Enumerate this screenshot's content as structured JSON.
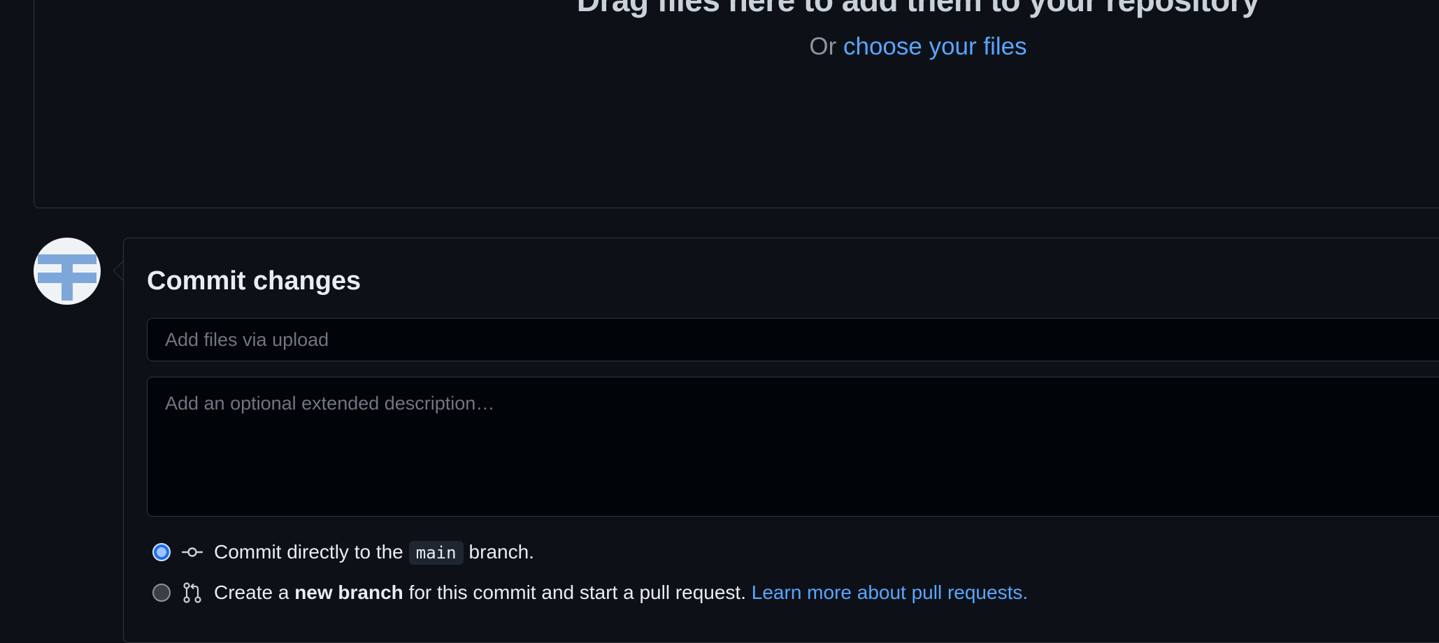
{
  "dropzone": {
    "title": "Drag files here to add them to your repository",
    "prefix": "Or",
    "link_label": "choose your files"
  },
  "commit": {
    "title": "Commit changes",
    "summary_placeholder": "Add files via upload",
    "description_placeholder": "Add an optional extended description…",
    "option_direct": {
      "before": "Commit directly to the",
      "branch": "main",
      "after": "branch."
    },
    "option_new_branch": {
      "before": "Create a",
      "bold": "new branch",
      "middle": "for this commit and start a pull request.",
      "link": "Learn more about pull requests."
    }
  },
  "icons": {
    "avatar": "identicon-avatar",
    "commit": "git-commit-icon",
    "pull_request": "git-pull-request-icon"
  },
  "colors": {
    "background": "#0d1117",
    "border": "#30363d",
    "link": "#58a6ff",
    "muted_text": "#8b949e",
    "avatar_block": "#7da7d9"
  }
}
